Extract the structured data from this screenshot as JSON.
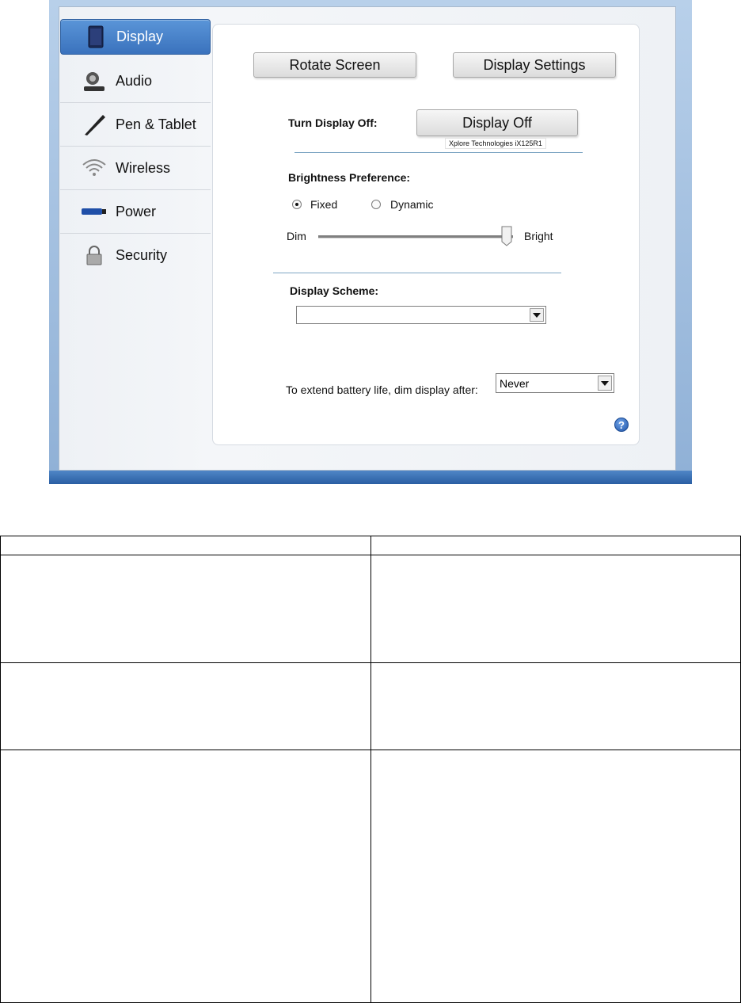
{
  "sidebar": {
    "items": [
      {
        "label": "Display",
        "icon": "tablet-display-icon",
        "active": true
      },
      {
        "label": "Audio",
        "icon": "speaker-headset-icon",
        "active": false
      },
      {
        "label": "Pen & Tablet",
        "icon": "pen-icon",
        "active": false
      },
      {
        "label": "Wireless",
        "icon": "wifi-icon",
        "active": false
      },
      {
        "label": "Power",
        "icon": "battery-icon",
        "active": false
      },
      {
        "label": "Security",
        "icon": "lock-icon",
        "active": false
      }
    ]
  },
  "display": {
    "rotate_screen_label": "Rotate Screen",
    "display_settings_label": "Display Settings",
    "turn_off_label": "Turn Display Off:",
    "display_off_label": "Display Off",
    "tooltip": "Xplore Technologies iX125R1",
    "brightness_label": "Brightness Preference:",
    "brightness_mode": {
      "fixed": "Fixed",
      "dynamic": "Dynamic",
      "selected": "Fixed"
    },
    "slider": {
      "min_label": "Dim",
      "max_label": "Bright",
      "level_fraction": 0.99
    },
    "scheme_label": "Display Scheme:",
    "scheme_value": "",
    "dim_label": "To extend battery life, dim display after:",
    "dim_value": "Never",
    "help_glyph": "?"
  },
  "colors": {
    "active_nav": "#3a72bd",
    "window_frame": "#8fb0d6",
    "help": "#1f54a8"
  }
}
